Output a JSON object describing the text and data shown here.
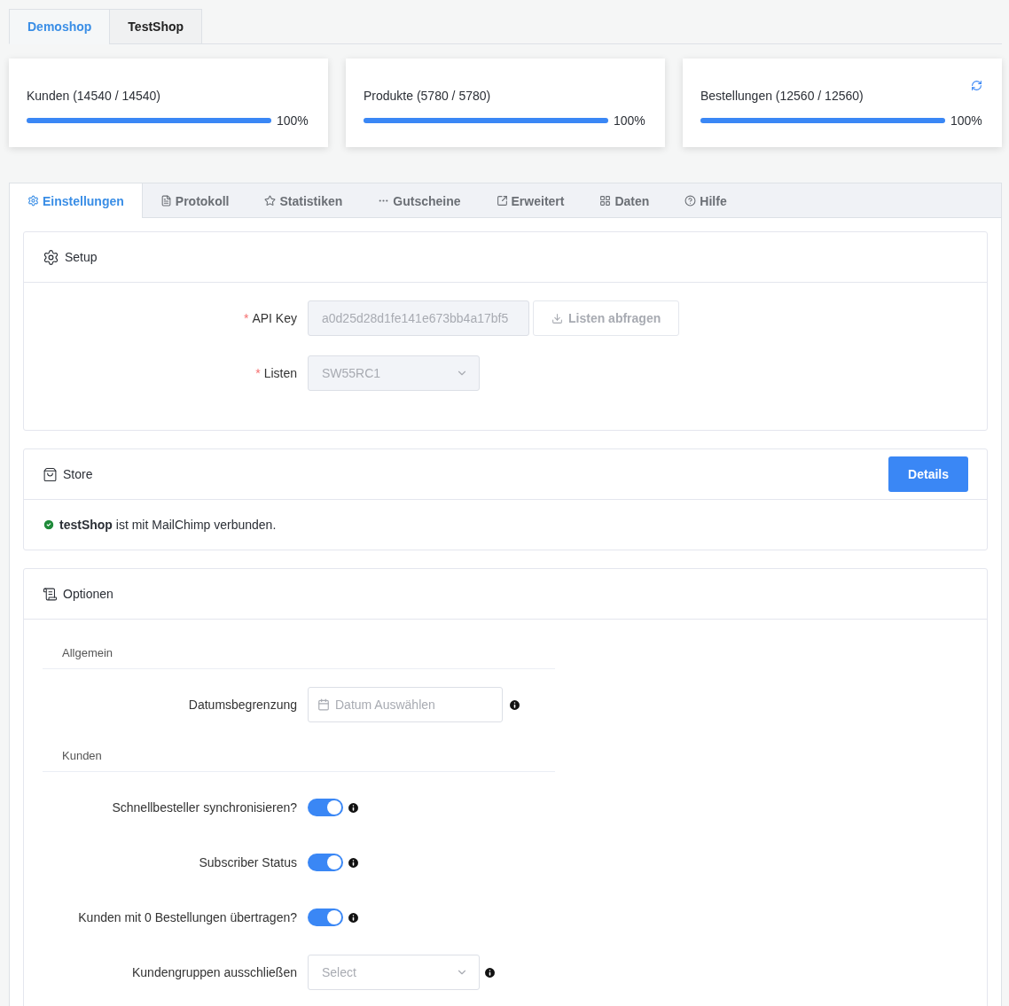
{
  "shop_tabs": [
    {
      "label": "Demoshop",
      "selected": true
    },
    {
      "label": "TestShop",
      "selected": false
    }
  ],
  "sync_cards": [
    {
      "label": "Kunden (14540 / 14540)",
      "level": 1,
      "percent": "100%",
      "refresh": false
    },
    {
      "label": "Produkte (5780 / 5780)",
      "level": 1,
      "percent": "100%",
      "refresh": false
    },
    {
      "label": "Bestellungen (12560 / 12560)",
      "level": 1,
      "percent": "100%",
      "refresh": true
    }
  ],
  "main_tabs": [
    {
      "label": "Einstellungen",
      "kind": "settings",
      "selected": true
    },
    {
      "label": "Protokoll",
      "kind": "document",
      "selected": false
    },
    {
      "label": "Statistiken",
      "kind": "star",
      "selected": false
    },
    {
      "label": "Gutscheine",
      "kind": "dots",
      "selected": false
    },
    {
      "label": "Erweitert",
      "kind": "expand",
      "selected": false
    },
    {
      "label": "Daten",
      "kind": "grid",
      "selected": false
    },
    {
      "label": "Hilfe",
      "kind": "help",
      "selected": false
    }
  ],
  "setup": {
    "title": "Setup",
    "api_key": {
      "label": "API Key",
      "required_mark": "*",
      "value": "a0d25d28d1fe141e673bb4a17bf5",
      "disabled": true
    },
    "fetch_button": "Listen abfragen",
    "lists": {
      "label": "Listen",
      "required_mark": "*",
      "value": "SW55RC1",
      "disabled": true
    }
  },
  "store": {
    "title": "Store",
    "button": "Details",
    "status": "**testShop** ist mit MailChimp verbunden.",
    "connected": true
  },
  "options": {
    "title": "Optionen",
    "sections": [
      {
        "title": "Allgemein",
        "rows": [
          {
            "kind": "date",
            "label": "Datumsbegrenzung",
            "placeholder": "Datum Auswählen"
          }
        ]
      },
      {
        "title": "Kunden",
        "rows": [
          {
            "kind": "toggle",
            "label": "Schnellbesteller synchronisieren?",
            "on": true
          },
          {
            "kind": "toggle",
            "label": "Subscriber Status",
            "on": true
          },
          {
            "kind": "toggle",
            "label": "Kunden mit 0 Bestellungen übertragen?",
            "on": true
          },
          {
            "kind": "select",
            "label": "Kundengruppen ausschließen",
            "placeholder": "Select"
          }
        ]
      }
    ]
  }
}
